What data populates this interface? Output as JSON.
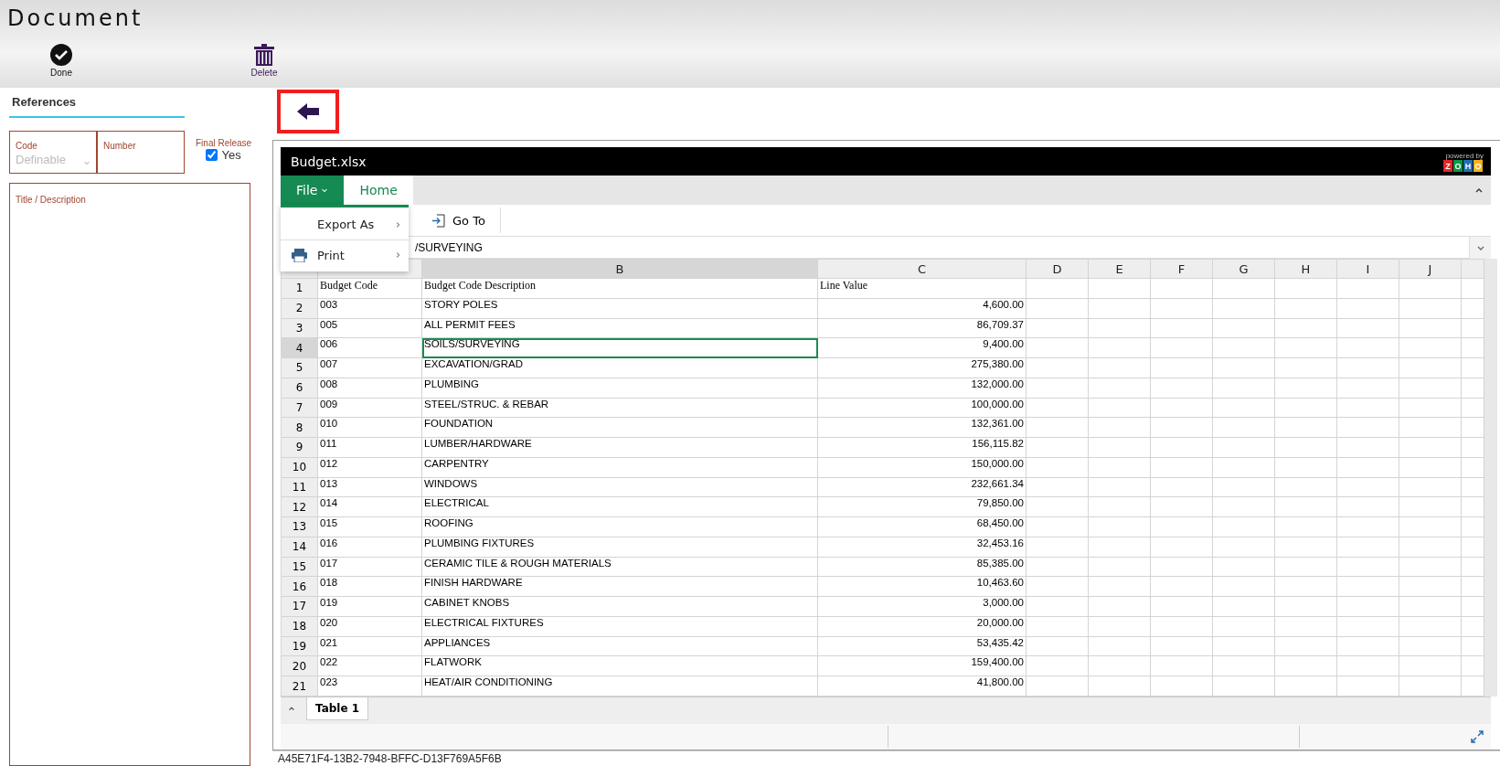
{
  "window": {
    "title": "Document"
  },
  "toolbar": [
    {
      "kind": "done",
      "label": "Done"
    },
    {
      "kind": "delete",
      "label": "Delete"
    }
  ],
  "references": {
    "heading": "References",
    "code": {
      "label": "Code",
      "placeholder": "Definable"
    },
    "number": {
      "label": "Number"
    },
    "final_release": {
      "label": "Final Release",
      "option": "Yes",
      "checked": true
    },
    "title_description": {
      "label": "Title / Description"
    }
  },
  "spreadsheet": {
    "file_name": "Budget.xlsx",
    "powered_by": "powered by",
    "brand_letters": [
      "Z",
      "O",
      "H",
      "O"
    ],
    "tabs": [
      {
        "label": "File",
        "selected": false
      },
      {
        "label": "Home",
        "selected": true
      }
    ],
    "file_menu": [
      {
        "kind": "plain",
        "label": "Export As"
      },
      {
        "kind": "print",
        "label": "Print"
      }
    ],
    "toolbar": [
      {
        "label": "Go To"
      }
    ],
    "formula": "/SURVEYING",
    "columns": [
      {},
      {
        "label": "B"
      },
      {
        "label": "C"
      },
      {
        "label": "D"
      },
      {
        "label": "E"
      },
      {
        "label": "F"
      },
      {
        "label": "G"
      },
      {
        "label": "H"
      },
      {
        "label": "I"
      },
      {
        "label": "J"
      }
    ],
    "rows": [
      {
        "num": "1",
        "cells": [
          "Budget Code",
          "Budget Code Description",
          "Line Value"
        ],
        "header": true,
        "selected": false
      },
      {
        "num": "2",
        "cells": [
          "003",
          "STORY POLES",
          "4,600.00"
        ],
        "header": false,
        "selected": false
      },
      {
        "num": "3",
        "cells": [
          "005",
          "ALL PERMIT FEES",
          "86,709.37"
        ],
        "header": false,
        "selected": false
      },
      {
        "num": "4",
        "cells": [
          "006",
          "SOILS/SURVEYING",
          "9,400.00"
        ],
        "header": false,
        "selected": true
      },
      {
        "num": "5",
        "cells": [
          "007",
          "EXCAVATION/GRAD",
          "275,380.00"
        ],
        "header": false,
        "selected": false
      },
      {
        "num": "6",
        "cells": [
          "008",
          "PLUMBING",
          "132,000.00"
        ],
        "header": false,
        "selected": false
      },
      {
        "num": "7",
        "cells": [
          "009",
          "STEEL/STRUC. & REBAR",
          "100,000.00"
        ],
        "header": false,
        "selected": false
      },
      {
        "num": "8",
        "cells": [
          "010",
          "FOUNDATION",
          "132,361.00"
        ],
        "header": false,
        "selected": false
      },
      {
        "num": "9",
        "cells": [
          "011",
          "LUMBER/HARDWARE",
          "156,115.82"
        ],
        "header": false,
        "selected": false
      },
      {
        "num": "10",
        "cells": [
          "012",
          "CARPENTRY",
          "150,000.00"
        ],
        "header": false,
        "selected": false
      },
      {
        "num": "11",
        "cells": [
          "013",
          "WINDOWS",
          "232,661.34"
        ],
        "header": false,
        "selected": false
      },
      {
        "num": "12",
        "cells": [
          "014",
          "ELECTRICAL",
          "79,850.00"
        ],
        "header": false,
        "selected": false
      },
      {
        "num": "13",
        "cells": [
          "015",
          "ROOFING",
          "68,450.00"
        ],
        "header": false,
        "selected": false
      },
      {
        "num": "14",
        "cells": [
          "016",
          "PLUMBING FIXTURES",
          "32,453.16"
        ],
        "header": false,
        "selected": false
      },
      {
        "num": "15",
        "cells": [
          "017",
          "CERAMIC TILE & ROUGH MATERIALS",
          "85,385.00"
        ],
        "header": false,
        "selected": false
      },
      {
        "num": "16",
        "cells": [
          "018",
          "FINISH HARDWARE",
          "10,463.60"
        ],
        "header": false,
        "selected": false
      },
      {
        "num": "17",
        "cells": [
          "019",
          "CABINET KNOBS",
          "3,000.00"
        ],
        "header": false,
        "selected": false
      },
      {
        "num": "18",
        "cells": [
          "020",
          "ELECTRICAL FIXTURES",
          "20,000.00"
        ],
        "header": false,
        "selected": false
      },
      {
        "num": "19",
        "cells": [
          "021",
          "APPLIANCES",
          "53,435.42"
        ],
        "header": false,
        "selected": false
      },
      {
        "num": "20",
        "cells": [
          "022",
          "FLATWORK",
          "159,400.00"
        ],
        "header": false,
        "selected": false
      },
      {
        "num": "21",
        "cells": [
          "023",
          "HEAT/AIR CONDITIONING",
          "41,800.00"
        ],
        "header": false,
        "selected": false
      }
    ],
    "sheets": [
      {
        "label": "Table 1",
        "selected": true
      }
    ]
  },
  "document_id": "A45E71F4-13B2-7948-BFFC-D13F769A5F6B"
}
